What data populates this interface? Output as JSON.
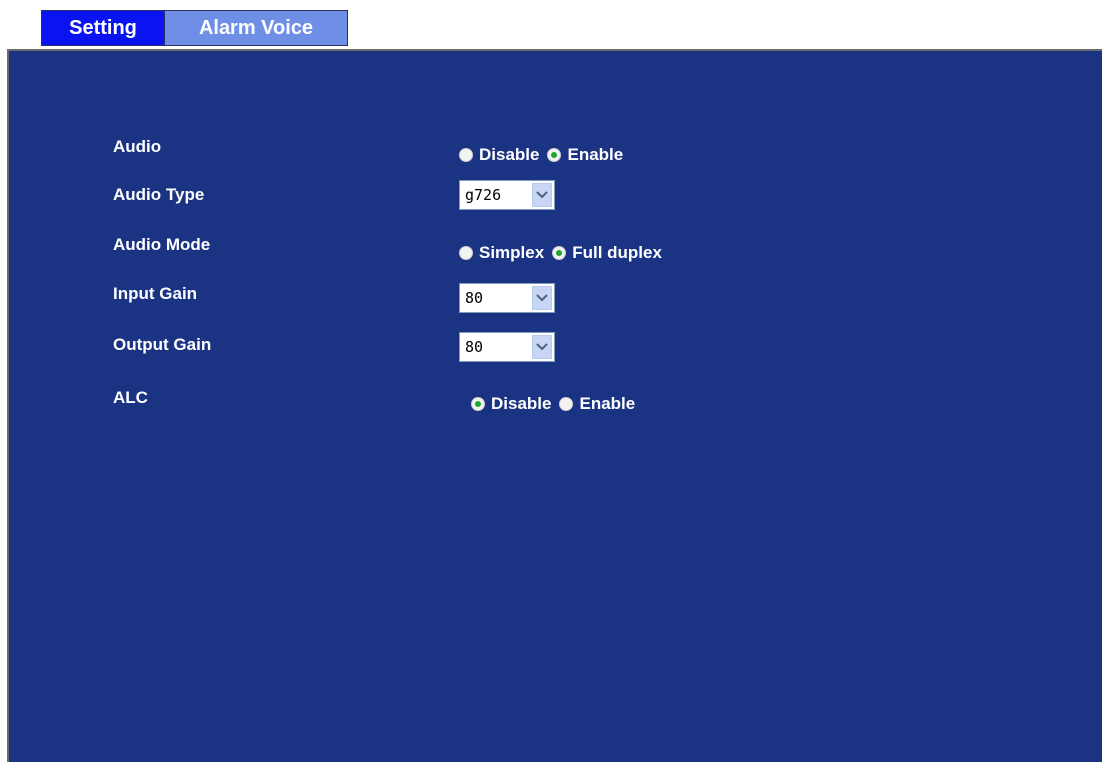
{
  "tabs": [
    {
      "label": "Setting"
    },
    {
      "label": "Alarm Voice"
    }
  ],
  "colors": {
    "panel": "#1a3383",
    "tab_active": "#0a14f0",
    "tab_inactive": "#6f8fe6",
    "radio_selected": "#1fa82f"
  },
  "form": {
    "audio": {
      "label": "Audio",
      "options": [
        {
          "label": "Disable",
          "checked": false
        },
        {
          "label": "Enable",
          "checked": true
        }
      ]
    },
    "audio_type": {
      "label": "Audio Type",
      "value": "g726"
    },
    "audio_mode": {
      "label": "Audio Mode",
      "options": [
        {
          "label": "Simplex",
          "checked": false
        },
        {
          "label": "Full duplex",
          "checked": true
        }
      ]
    },
    "input_gain": {
      "label": "Input Gain",
      "value": "80"
    },
    "output_gain": {
      "label": "Output Gain",
      "value": "80"
    },
    "alc": {
      "label": "ALC",
      "options": [
        {
          "label": "Disable",
          "checked": true
        },
        {
          "label": "Enable",
          "checked": false
        }
      ]
    }
  }
}
